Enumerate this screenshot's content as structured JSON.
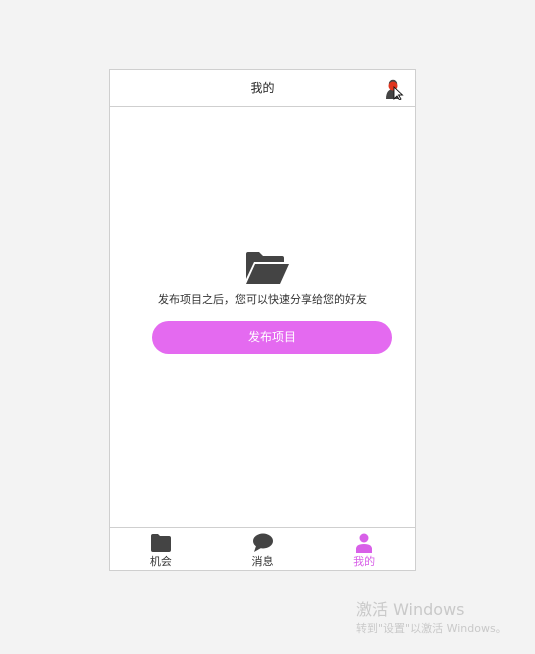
{
  "header": {
    "title": "我的",
    "user_icon": "user-icon"
  },
  "empty_state": {
    "icon": "folder-open-icon",
    "message": "发布项目之后，您可以快速分享给您的好友",
    "button_label": "发布项目"
  },
  "tabbar": {
    "tabs": [
      {
        "label": "机会",
        "icon": "folder-icon",
        "active": false
      },
      {
        "label": "消息",
        "icon": "chat-bubble-icon",
        "active": false
      },
      {
        "label": "我的",
        "icon": "person-icon",
        "active": true
      }
    ]
  },
  "watermark": {
    "title": "激活 Windows",
    "subtitle": "转到\"设置\"以激活 Windows。"
  },
  "colors": {
    "accent": "#e46af0",
    "active_tab": "#d860e8",
    "icon_dark": "#444444",
    "cursor_dot": "#e0341e"
  }
}
